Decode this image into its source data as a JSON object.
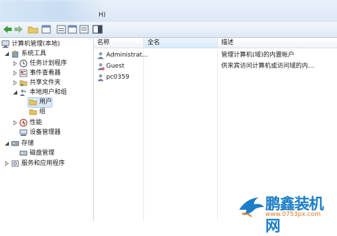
{
  "menu": {
    "help_fragment": "H)"
  },
  "tree": {
    "root": "计算机管理(本地)",
    "system_tools": "系统工具",
    "task_scheduler": "任务计划程序",
    "event_viewer": "事件查看器",
    "shared_folders": "共享文件夹",
    "local_users_groups": "本地用户和组",
    "users": "用户",
    "groups": "组",
    "performance": "性能",
    "device_manager": "设备管理器",
    "storage": "存储",
    "disk_management": "磁盘管理",
    "services_apps": "服务和应用程序"
  },
  "list": {
    "columns": [
      "名称",
      "全名",
      "描述"
    ],
    "rows": [
      {
        "name": "Administrat...",
        "full_name": "",
        "description": "管理计算机(域)的内置帐户"
      },
      {
        "name": "Guest",
        "full_name": "",
        "description": "供来宾访问计算机或访问域的内..."
      },
      {
        "name": "pc0359",
        "full_name": "",
        "description": ""
      }
    ]
  },
  "watermark": {
    "brand": "鹏鑫装机网",
    "url": "www.0753px.com"
  }
}
